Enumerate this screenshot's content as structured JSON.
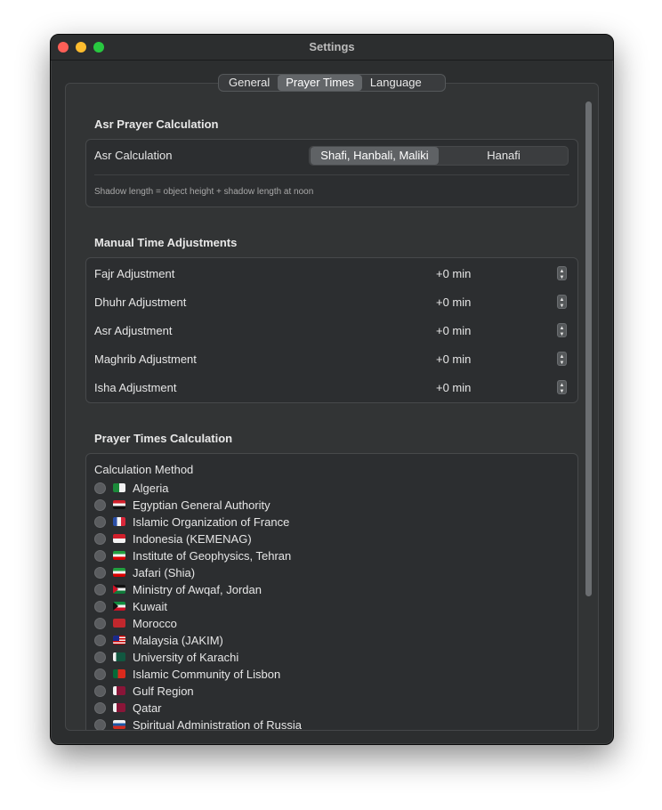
{
  "window": {
    "title": "Settings"
  },
  "tabs": {
    "items": [
      "General",
      "Prayer Times",
      "Language"
    ],
    "selected": "Prayer Times"
  },
  "asr_section": {
    "title": "Asr Prayer Calculation",
    "label": "Asr Calculation",
    "options": [
      "Shafi, Hanbali, Maliki",
      "Hanafi"
    ],
    "selected": "Shafi, Hanbali, Maliki",
    "hint": "Shadow length = object height + shadow length at noon"
  },
  "adjust_section": {
    "title": "Manual Time Adjustments",
    "rows": [
      {
        "label": "Fajr Adjustment",
        "value": "+0 min"
      },
      {
        "label": "Dhuhr Adjustment",
        "value": "+0 min"
      },
      {
        "label": "Asr Adjustment",
        "value": "+0 min"
      },
      {
        "label": "Maghrib Adjustment",
        "value": "+0 min"
      },
      {
        "label": "Isha Adjustment",
        "value": "+0 min"
      }
    ]
  },
  "method_section": {
    "title": "Prayer Times Calculation",
    "header": "Calculation Method",
    "methods": [
      {
        "label": "Algeria",
        "flag": "dz"
      },
      {
        "label": "Egyptian General Authority",
        "flag": "eg"
      },
      {
        "label": "Islamic Organization of France",
        "flag": "fr"
      },
      {
        "label": "Indonesia (KEMENAG)",
        "flag": "id"
      },
      {
        "label": "Institute of Geophysics, Tehran",
        "flag": "ir"
      },
      {
        "label": "Jafari (Shia)",
        "flag": "ir"
      },
      {
        "label": "Ministry of Awqaf, Jordan",
        "flag": "jo"
      },
      {
        "label": "Kuwait",
        "flag": "kw"
      },
      {
        "label": "Morocco",
        "flag": "ma"
      },
      {
        "label": "Malaysia (JAKIM)",
        "flag": "my"
      },
      {
        "label": "University of Karachi",
        "flag": "pk"
      },
      {
        "label": "Islamic Community of Lisbon",
        "flag": "pt"
      },
      {
        "label": "Gulf Region",
        "flag": "qa"
      },
      {
        "label": "Qatar",
        "flag": "qa"
      },
      {
        "label": "Spiritual Administration of Russia",
        "flag": "ru"
      }
    ]
  }
}
